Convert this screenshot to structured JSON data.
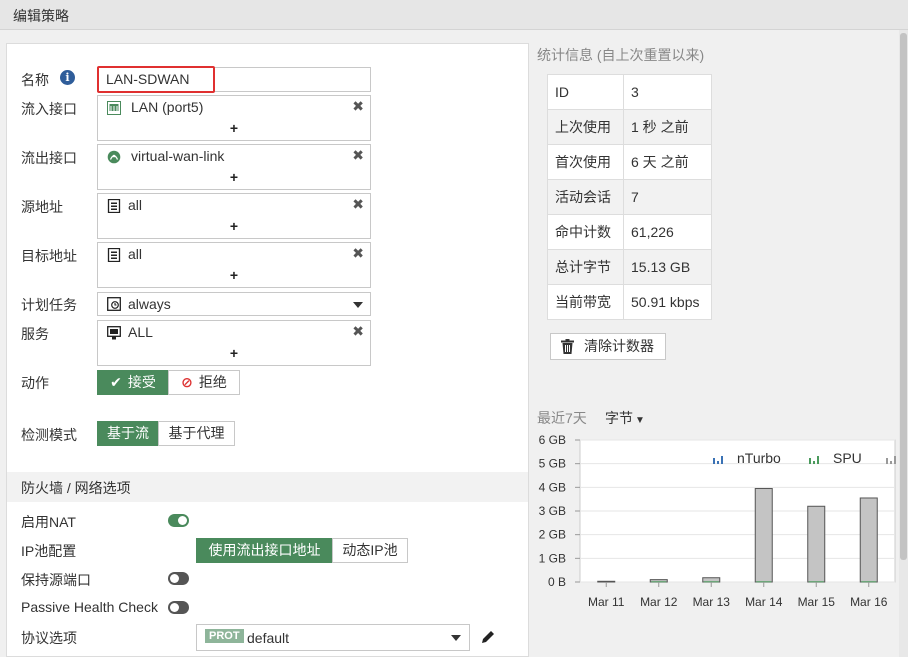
{
  "window": {
    "title": "编辑策略"
  },
  "form": {
    "name_label": "名称",
    "name_value": "LAN-SDWAN",
    "incoming_label": "流入接口",
    "incoming_value": "LAN (port5)",
    "outgoing_label": "流出接口",
    "outgoing_value": "virtual-wan-link",
    "source_label": "源地址",
    "source_value": "all",
    "destination_label": "目标地址",
    "destination_value": "all",
    "schedule_label": "计划任务",
    "schedule_value": "always",
    "service_label": "服务",
    "service_value": "ALL",
    "plus": "+",
    "remove": "✖",
    "action_label": "动作",
    "action_accept": "接受",
    "action_deny": "拒绝",
    "inspection_label": "检测模式",
    "inspection_flow": "基于流",
    "inspection_proxy": "基于代理"
  },
  "firewall": {
    "section_title": "防火墙 / 网络选项",
    "nat_label": "启用NAT",
    "nat_enabled": true,
    "ippool_label": "IP池配置",
    "ippool_outgoing": "使用流出接口地址",
    "ippool_dynamic": "动态IP池",
    "preserve_port_label": "保持源端口",
    "preserve_port_enabled": false,
    "passive_health_label": "Passive Health Check",
    "passive_health_enabled": false,
    "protocol_label": "协议选项",
    "protocol_badge": "PROT",
    "protocol_value": "default"
  },
  "stats": {
    "title": "统计信息 (自上次重置以来)",
    "rows": [
      {
        "k": "ID",
        "v": "3"
      },
      {
        "k": "上次使用",
        "v": "1 秒 之前"
      },
      {
        "k": "首次使用",
        "v": "6 天 之前"
      },
      {
        "k": "活动会话",
        "v": "7"
      },
      {
        "k": "命中计数",
        "v": "61,226"
      },
      {
        "k": "总计字节",
        "v": "15.13 GB"
      },
      {
        "k": "当前带宽",
        "v": "50.91 kbps"
      }
    ],
    "clear_button": "清除计数器"
  },
  "chart_header": {
    "period": "最近7天",
    "unit_dropdown": "字节"
  },
  "colors": {
    "accent": "#4a8a5c",
    "bar_fill": "#c4c4c4",
    "bar_stroke": "#555555",
    "nturbo": "#3a72b5",
    "spu": "#4a9a5c",
    "highlight_border": "#e03030"
  },
  "chart_data": {
    "type": "bar",
    "categories": [
      "Mar 11",
      "Mar 12",
      "Mar 13",
      "Mar 14",
      "Mar 15",
      "Mar 16"
    ],
    "yticks": [
      "0 B",
      "1 GB",
      "2 GB",
      "3 GB",
      "4 GB",
      "5 GB",
      "6 GB"
    ],
    "ylim": [
      0,
      6
    ],
    "grid": true,
    "legend_position": "top-right",
    "legend": [
      "nTurbo",
      "SPU"
    ],
    "series": [
      {
        "values": [
          0.03,
          0.1,
          0.18,
          3.95,
          3.2,
          3.55
        ]
      },
      {
        "name": "nTurbo",
        "values": [
          0,
          0,
          0,
          0,
          0,
          0
        ]
      },
      {
        "name": "SPU",
        "values": [
          0,
          0.03,
          0.03,
          0.03,
          0.03,
          0.03
        ]
      }
    ]
  }
}
